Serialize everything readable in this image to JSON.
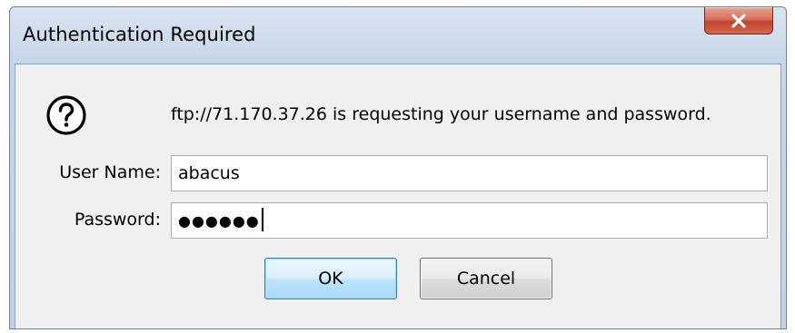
{
  "window": {
    "title": "Authentication Required",
    "close_icon": "close-icon"
  },
  "dialog": {
    "icon": "question-icon",
    "message": "ftp://71.170.37.26 is requesting your username and password.",
    "username_label": "User Name:",
    "username_value": "abacus",
    "password_label": "Password:",
    "password_value": "●●●●●●"
  },
  "buttons": {
    "ok_label": "OK",
    "cancel_label": "Cancel"
  },
  "colors": {
    "title_bar": "#c7d6e8",
    "client_bg": "#f0f0f0",
    "close_red": "#c2432d",
    "ok_focus": "#3c7fb1"
  }
}
